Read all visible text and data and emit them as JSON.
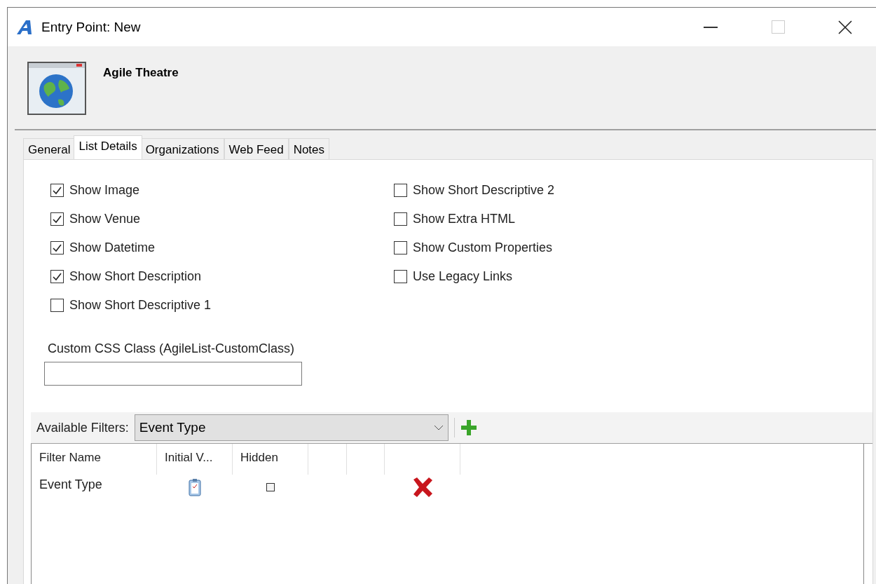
{
  "window": {
    "title": "Entry Point: New"
  },
  "header": {
    "title": "Agile Theatre"
  },
  "tabs": [
    {
      "label": "General",
      "selected": false
    },
    {
      "label": "List Details",
      "selected": true
    },
    {
      "label": "Organizations",
      "selected": false
    },
    {
      "label": "Web Feed",
      "selected": false
    },
    {
      "label": "Notes",
      "selected": false
    }
  ],
  "options_left": [
    {
      "label": "Show Image",
      "checked": true
    },
    {
      "label": "Show Venue",
      "checked": true
    },
    {
      "label": "Show Datetime",
      "checked": true
    },
    {
      "label": "Show Short Description",
      "checked": true
    },
    {
      "label": "Show Short Descriptive 1",
      "checked": false
    }
  ],
  "options_right": [
    {
      "label": "Show Short Descriptive 2",
      "checked": false
    },
    {
      "label": "Show Extra HTML",
      "checked": false
    },
    {
      "label": "Show Custom Properties",
      "checked": false
    },
    {
      "label": "Use Legacy Links",
      "checked": false
    }
  ],
  "css_class": {
    "label": "Custom CSS Class (AgileList-CustomClass)"
  },
  "filters": {
    "label": "Available Filters:",
    "value": "Event Type"
  },
  "grid": {
    "columns": [
      "Filter Name",
      "Initial V...",
      "Hidden"
    ],
    "rows": [
      {
        "name": "Event Type",
        "hidden": false
      }
    ]
  }
}
